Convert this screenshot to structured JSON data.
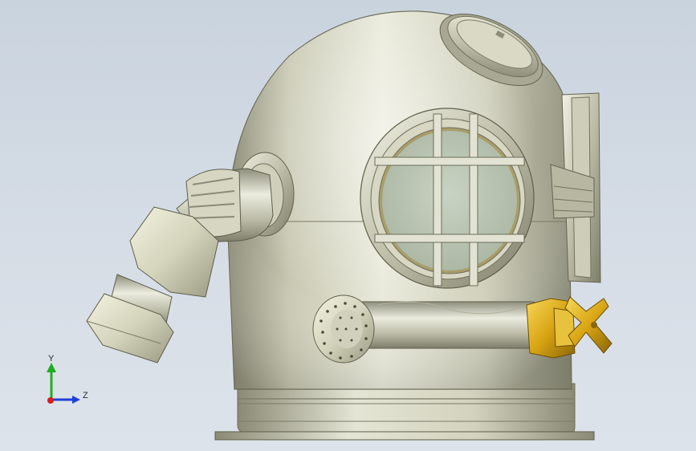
{
  "viewport": {
    "background_top": "#c9d3de",
    "background_bottom": "#dde3ea"
  },
  "model": {
    "helmet_color": "#c9c9b4",
    "valve_color": "#e0b21a",
    "glass_color": "#b9c5b0"
  },
  "triad": {
    "y_label": "Y",
    "z_label": "Z",
    "y_color": "#1fae1f",
    "z_color": "#1f3fd6",
    "x_color": "#d01f1f"
  }
}
